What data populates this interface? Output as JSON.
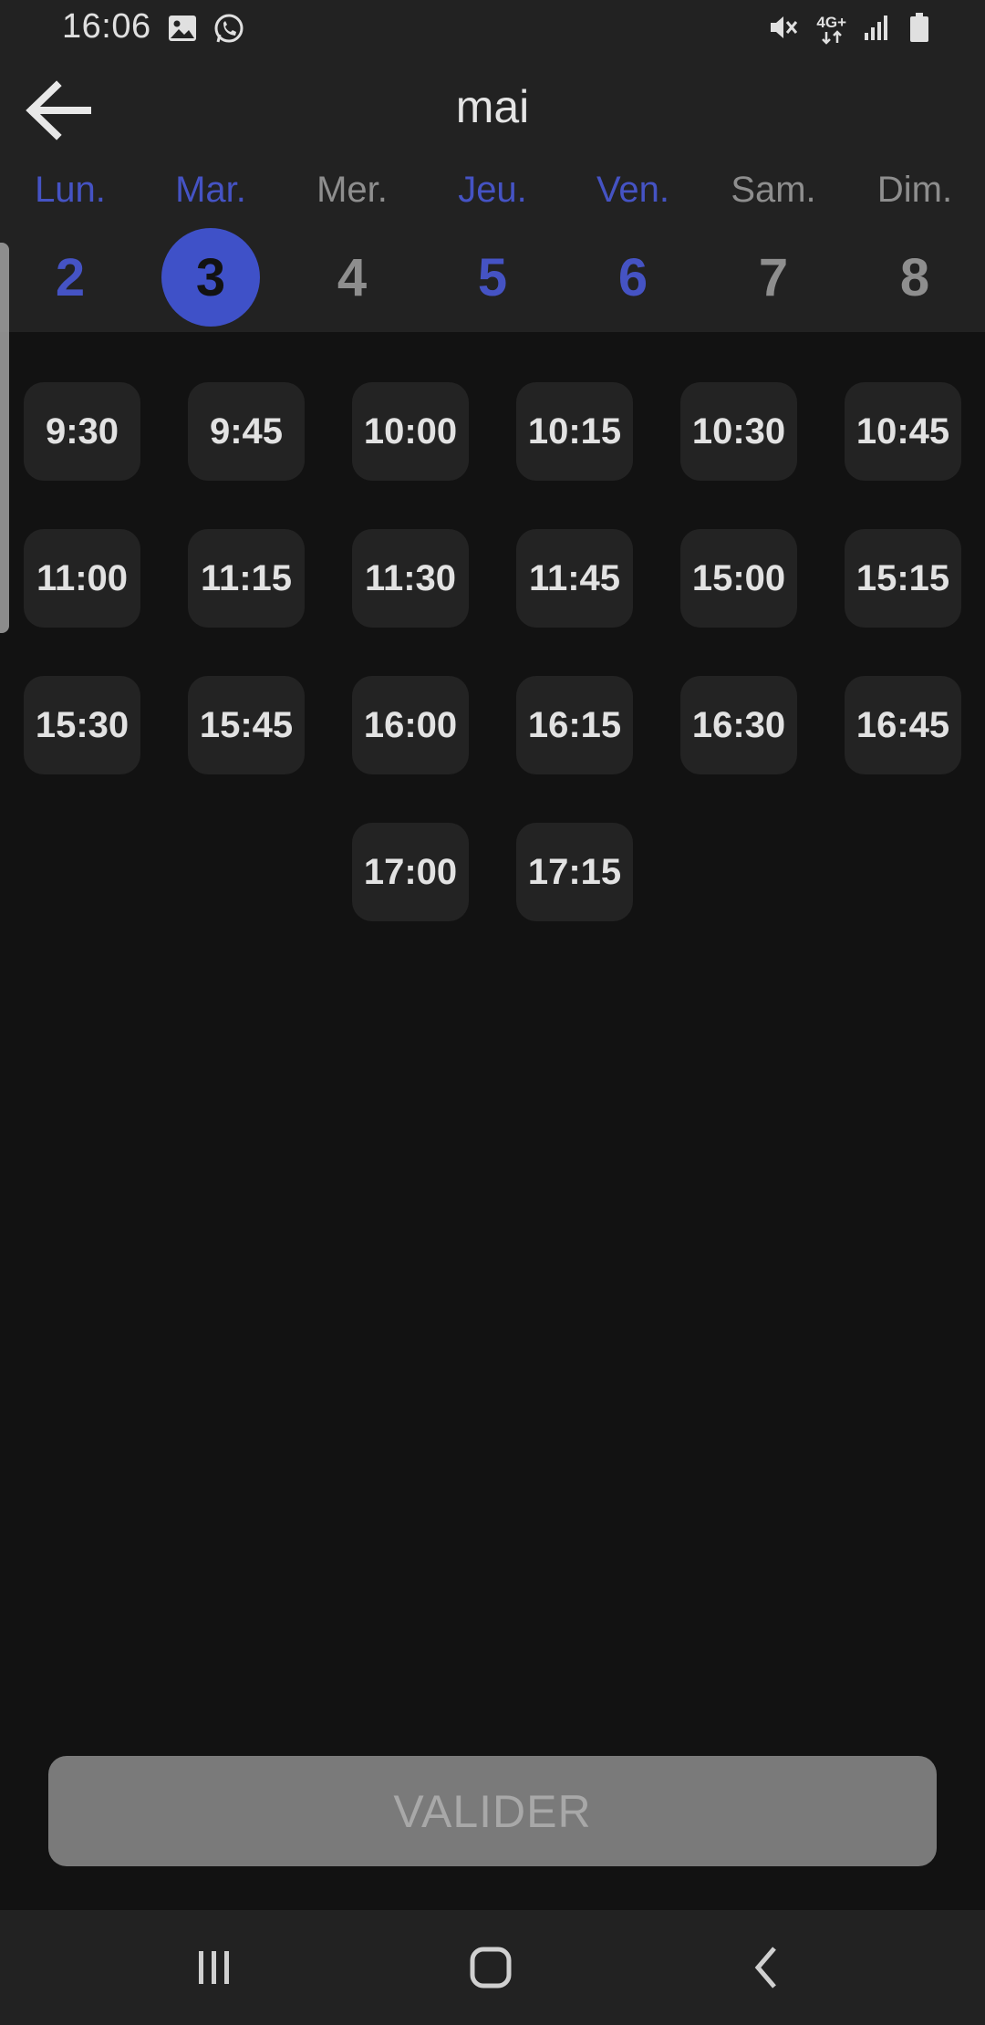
{
  "status_bar": {
    "time": "16:06",
    "network_label": "4G+"
  },
  "header": {
    "month": "mai"
  },
  "week": [
    {
      "label": "Lun.",
      "number": "2",
      "state": "available"
    },
    {
      "label": "Mar.",
      "number": "3",
      "state": "selected"
    },
    {
      "label": "Mer.",
      "number": "4",
      "state": "unavailable"
    },
    {
      "label": "Jeu.",
      "number": "5",
      "state": "available"
    },
    {
      "label": "Ven.",
      "number": "6",
      "state": "available"
    },
    {
      "label": "Sam.",
      "number": "7",
      "state": "unavailable"
    },
    {
      "label": "Dim.",
      "number": "8",
      "state": "unavailable"
    }
  ],
  "time_slots": [
    "9:30",
    "9:45",
    "10:00",
    "10:15",
    "10:30",
    "10:45",
    "11:00",
    "11:15",
    "11:30",
    "11:45",
    "15:00",
    "15:15",
    "15:30",
    "15:45",
    "16:00",
    "16:15",
    "16:30",
    "16:45",
    "17:00",
    "17:15"
  ],
  "actions": {
    "validate_label": "VALIDER"
  },
  "colors": {
    "accent": "#3f51c8",
    "available_text": "#4553c4",
    "unavailable_text": "#8e8e8e",
    "background": "#121212",
    "header_background": "#222222",
    "slot_background": "#232323",
    "disabled_button": "#7a7a7a"
  }
}
